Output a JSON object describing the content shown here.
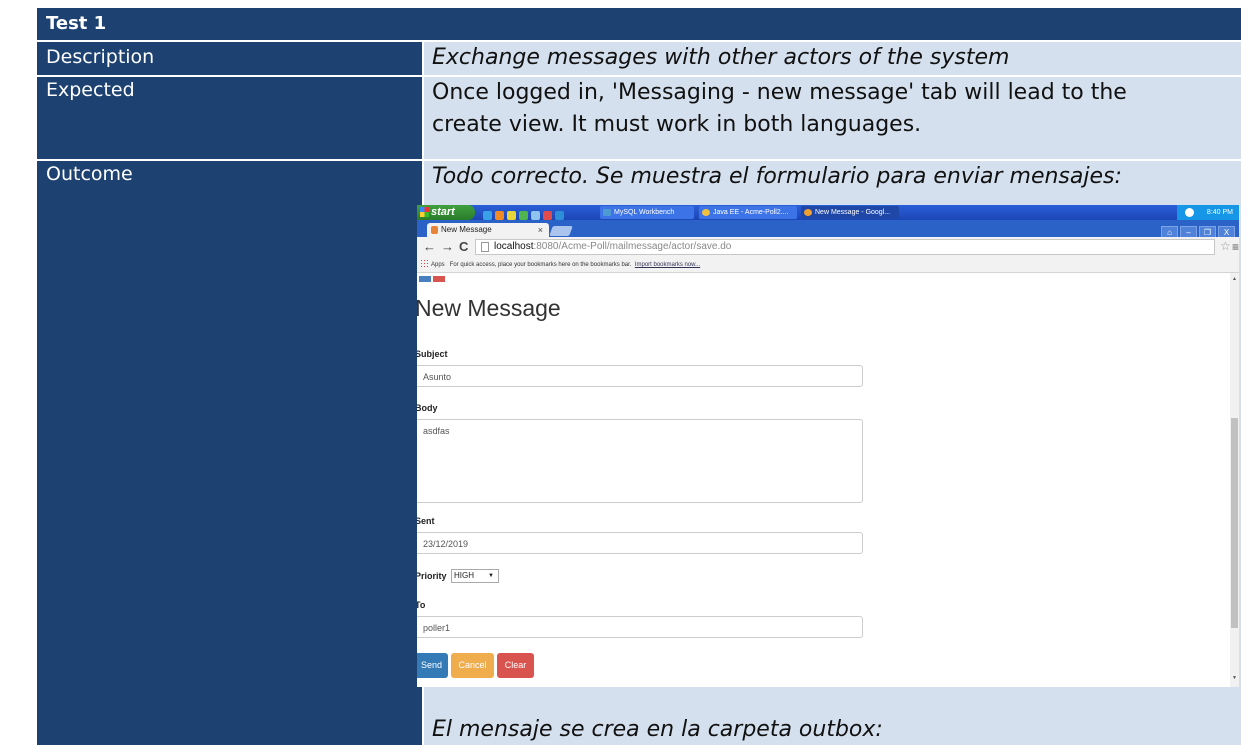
{
  "table": {
    "title": "Test 1",
    "rows": [
      {
        "label": "Description",
        "value": "Exchange messages with other actors of the system"
      },
      {
        "label": "Expected",
        "value_line1": "Once logged in, 'Messaging  - new message' tab will lead to the",
        "value_line2": "create view. It must work in both languages."
      },
      {
        "label": "Outcome",
        "value": "Todo correcto. Se muestra el formulario para enviar mensajes:",
        "footer": "El mensaje se crea en la carpeta outbox:"
      }
    ],
    "colors": {
      "header_bg": "#1d4272",
      "value_bg": "#d5e0ee",
      "label_text": "#ffffff"
    }
  },
  "screenshot": {
    "taskbar": {
      "start_label": "start",
      "items": [
        "MySQL Workbench",
        "Java EE - Acme-Poll2....",
        "New Message - Googl..."
      ],
      "clock": "8:40 PM"
    },
    "browser": {
      "tab_title": "New Message",
      "tab_close": "×",
      "back": "←",
      "forward": "→",
      "reload": "C",
      "url_host": "localhost",
      "url_rest": ":8080/Acme-Poll/mailmessage/actor/save.do",
      "bookmarks_apps": "Apps",
      "bookmarks_hint": "For quick access, place your bookmarks here on the bookmarks bar.",
      "bookmarks_link": "Import bookmarks now...",
      "menu": "≡",
      "star": "☆",
      "win_controls": [
        "⌂",
        "–",
        "❐",
        "X"
      ]
    },
    "form": {
      "heading": "New Message",
      "subject_label": "Subject",
      "subject_value": "Asunto",
      "body_label": "Body",
      "body_value": "asdfas",
      "sent_label": "Sent",
      "sent_value": "23/12/2019",
      "priority_label": "Priority",
      "priority_value": "HIGH",
      "to_label": "To",
      "to_value": "poller1",
      "send_label": "Send",
      "cancel_label": "Cancel",
      "clear_label": "Clear"
    },
    "colors": {
      "send": "#337ab7",
      "cancel": "#f0ad4e",
      "clear": "#d9534f",
      "taskbar": "#2a5fd8"
    }
  }
}
